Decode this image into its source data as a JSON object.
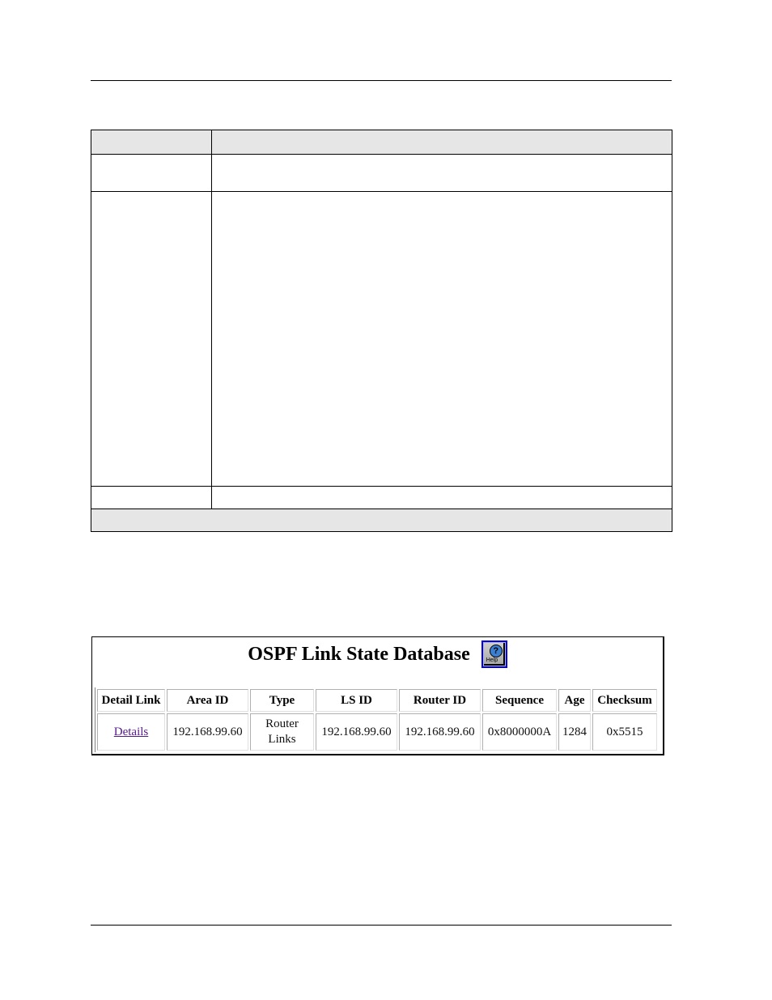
{
  "reference_table": {
    "rows": [
      {
        "type": "header",
        "cells": [
          "",
          ""
        ]
      },
      {
        "type": "row",
        "cells": [
          "",
          ""
        ]
      },
      {
        "type": "row",
        "cells": [
          "",
          ""
        ]
      },
      {
        "type": "row",
        "cells": [
          "",
          ""
        ]
      },
      {
        "type": "footer",
        "cells": [
          ""
        ]
      }
    ]
  },
  "ospf_screen": {
    "title": "OSPF Link State Database",
    "help_button": {
      "icon": "help-icon",
      "label": "Help"
    },
    "columns": [
      "Detail Link",
      "Area ID",
      "Type",
      "LS ID",
      "Router ID",
      "Sequence",
      "Age",
      "Checksum"
    ],
    "rows": [
      {
        "detail_link": "Details",
        "area_id": "192.168.99.60",
        "type": "Router Links",
        "ls_id": "192.168.99.60",
        "router_id": "192.168.99.60",
        "sequence": "0x8000000A",
        "age": "1284",
        "checksum": "0x5515"
      }
    ],
    "colors": {
      "link": "#551a8b",
      "help_border": "#0000ee"
    }
  }
}
